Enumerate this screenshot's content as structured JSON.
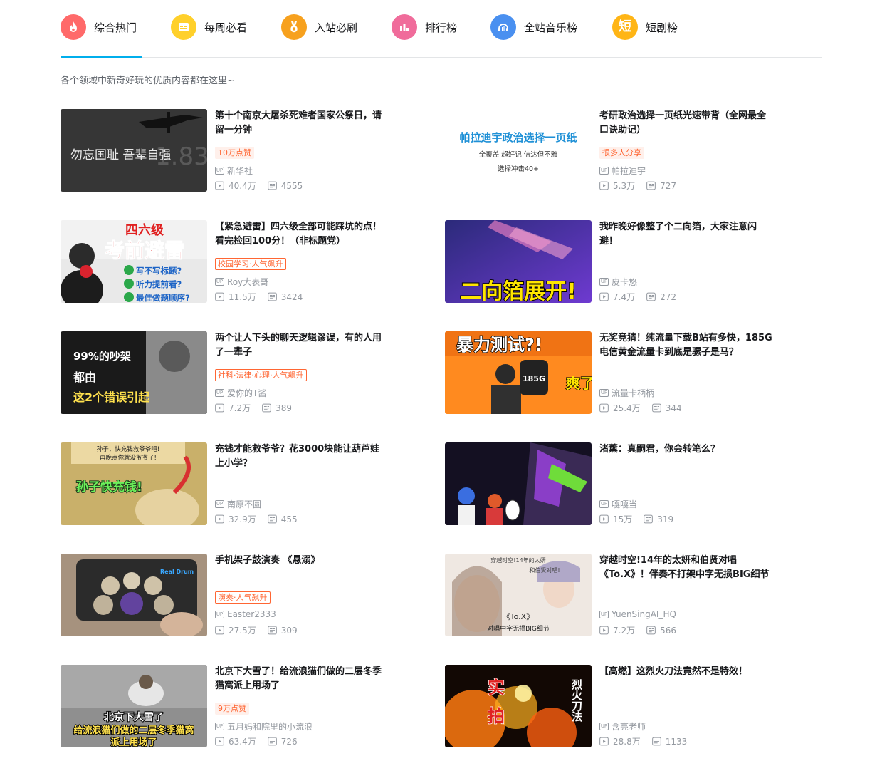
{
  "tabs": [
    {
      "label": "综合热门",
      "icon": "flame-icon",
      "color": "#ff6a6a",
      "active": true
    },
    {
      "label": "每周必看",
      "icon": "calendar-icon",
      "color": "#ffd02b"
    },
    {
      "label": "入站必刷",
      "icon": "medal-icon",
      "color": "#f7a11e"
    },
    {
      "label": "排行榜",
      "icon": "bar-chart-icon",
      "color": "#f06c9b"
    },
    {
      "label": "全站音乐榜",
      "icon": "headphones-icon",
      "color": "#4a90f0"
    },
    {
      "label": "短剧榜",
      "icon": "short-drama-icon",
      "glyph": "短",
      "color": "#ffb515"
    }
  ],
  "colors": {
    "accent": "#00aeec",
    "tag": "#ff6633",
    "meta": "#9499a0"
  },
  "subtitle": "各个领域中新奇好玩的优质内容都在这里~",
  "videos": [
    {
      "title": "第十个南京大屠杀死难者国家公祭日，请留一分钟",
      "tag": "10万点赞",
      "tag_style": "fill",
      "author": "新华社",
      "views": "40.4万",
      "comments": "4555",
      "cover_text": [
        "勿忘国耻  吾辈自强"
      ]
    },
    {
      "title": "考研政治选择一页纸光速带背（全网最全口诀助记）",
      "tag": "很多人分享",
      "tag_style": "fill",
      "author": "帕拉迪宇",
      "views": "5.3万",
      "comments": "727",
      "cover_text": [
        "帕拉迪宇政治选择一页纸",
        "全覆盖    超好记    信达但不雅",
        "选择冲击40+"
      ]
    },
    {
      "title": "【紧急避雷】四六级全部可能踩坑的点！看完捡回100分！（非标题党）",
      "tag": "校园学习·人气飙升",
      "tag_style": "line",
      "author": "Roy大表哥",
      "views": "11.5万",
      "comments": "3424",
      "cover_text": [
        "四六级",
        "考前避雷",
        "写不写标题?",
        "听力提前看?",
        "最佳做题顺序?"
      ]
    },
    {
      "title": "我昨晚好像整了个二向箔，大家注意闪避！",
      "tag": "",
      "tag_style": "none",
      "author": "皮卡悠",
      "views": "7.4万",
      "comments": "272",
      "cover_text": [
        "二向箔展开!"
      ]
    },
    {
      "title": "两个让人下头的聊天逻辑谬误，有的人用了一辈子",
      "tag": "社科·法律·心理·人气飙升",
      "tag_style": "line",
      "author": "爱你的T酱",
      "views": "7.2万",
      "comments": "389",
      "cover_text": [
        "99%的吵架",
        "都由",
        "这2个错误引起"
      ]
    },
    {
      "title": "无奖竞猜！纯流量下载B站有多快，185G电信黄金流量卡到底是骡子是马？",
      "tag": "",
      "tag_style": "none",
      "author": "流量卡柄柄",
      "views": "25.4万",
      "comments": "344",
      "cover_text": [
        "暴力测试?!",
        "185G",
        "爽了"
      ]
    },
    {
      "title": "充钱才能救爷爷？花3000块能让葫芦娃上小学？",
      "tag": "",
      "tag_style": "none",
      "author": "南原不圆",
      "views": "32.9万",
      "comments": "455",
      "cover_text": [
        "孙子，快充钱救爷爷吧!",
        "再晚点你就没爷爷了!",
        "孙子快充钱!"
      ]
    },
    {
      "title": "渚薰：真嗣君，你会转笔么？",
      "tag": "",
      "tag_style": "none",
      "author": "嘎嘎当",
      "views": "15万",
      "comments": "319",
      "cover_text": []
    },
    {
      "title": "手机架子鼓演奏 《悬溺》",
      "tag": "演奏·人气飙升",
      "tag_style": "line",
      "author": "Easter2333",
      "views": "27.5万",
      "comments": "309",
      "cover_text": [
        "Real Drum"
      ]
    },
    {
      "title": "穿越时空!14年的太妍和伯贤对唱《To.X》！伴奏不打架中字无损BIG细节",
      "tag": "",
      "tag_style": "none",
      "author": "YuenSingAI_HQ",
      "views": "7.2万",
      "comments": "566",
      "cover_text": [
        "穿越时空!14年的太妍",
        "和伯贤对唱!",
        "《To.X》",
        "对唱中字无损BIG细节"
      ]
    },
    {
      "title": "北京下大雪了！给流浪猫们做的二层冬季猫窝派上用场了",
      "tag": "9万点赞",
      "tag_style": "fill",
      "author": "五月妈和院里的小流浪",
      "views": "63.4万",
      "comments": "726",
      "cover_text": [
        "北京下大雪了",
        "给流浪猫们做的二层冬季猫窝",
        "派上用场了"
      ]
    },
    {
      "title": "【高燃】这烈火刀法竟然不是特效！",
      "tag": "",
      "tag_style": "none",
      "author": "含亮老师",
      "views": "28.8万",
      "comments": "1133",
      "cover_text": [
        "实",
        "拍",
        "烈火刀法"
      ]
    }
  ]
}
